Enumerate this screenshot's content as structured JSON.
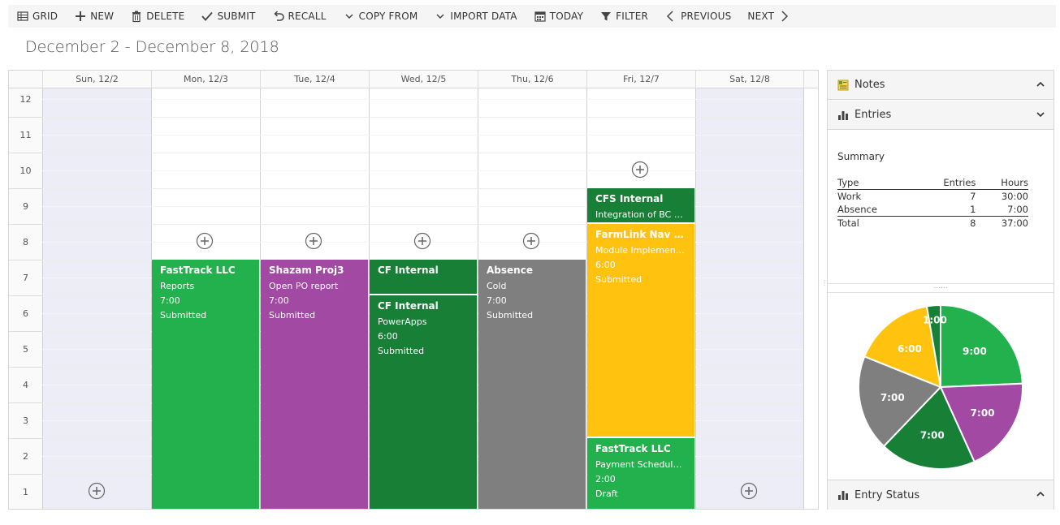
{
  "toolbar": {
    "grid": "GRID",
    "new": "NEW",
    "delete": "DELETE",
    "submit": "SUBMIT",
    "recall": "RECALL",
    "copy_from": "COPY FROM",
    "import_data": "IMPORT DATA",
    "today": "TODAY",
    "filter": "FILTER",
    "previous": "PREVIOUS",
    "next": "NEXT"
  },
  "title": "December 2 - December 8, 2018",
  "days": [
    "Sun, 12/2",
    "Mon, 12/3",
    "Tue, 12/4",
    "Wed, 12/5",
    "Thu, 12/6",
    "Fri, 12/7",
    "Sat, 12/8"
  ],
  "hours": [
    "12",
    "11",
    "10",
    "9",
    "8",
    "7",
    "6",
    "5",
    "4",
    "3",
    "2",
    "1"
  ],
  "entries": {
    "mon": {
      "title": "FastTrack LLC",
      "desc": "Reports",
      "hours": "7:00",
      "status": "Submitted",
      "color": "#22b14c"
    },
    "tue": {
      "title": "Shazam Proj3",
      "desc": "Open PO report",
      "hours": "7:00",
      "status": "Submitted",
      "color": "#a249a4"
    },
    "wed1": {
      "title": "CF Internal",
      "color": "#187f37"
    },
    "wed2": {
      "title": "CF Internal",
      "desc": "PowerApps",
      "hours": "6:00",
      "status": "Submitted",
      "color": "#187f37"
    },
    "thu": {
      "title": "Absence",
      "desc": "Cold",
      "hours": "7:00",
      "status": "Submitted",
      "color": "#7f7f7f"
    },
    "fri1": {
      "title": "CFS Internal",
      "desc": "Integration of BC to ...",
      "color": "#187f37"
    },
    "fri2": {
      "title": "FarmLink Nav Impl...",
      "desc": "Module Implementati...",
      "hours": "6:00",
      "status": "Submitted",
      "color": "#ffc20e"
    },
    "fri3": {
      "title": "FastTrack LLC",
      "desc": "Payment Schedule Re...",
      "hours": "2:00",
      "status": "Draft",
      "color": "#22b14c"
    }
  },
  "panel": {
    "notes": "Notes",
    "entries": "Entries",
    "entry_status": "Entry Status",
    "summary_title": "Summary",
    "summary": {
      "headers": [
        "Type",
        "Entries",
        "Hours"
      ],
      "rows": [
        {
          "type": "Work",
          "entries": "7",
          "hours": "30:00"
        },
        {
          "type": "Absence",
          "entries": "1",
          "hours": "7:00"
        }
      ],
      "total": {
        "type": "Total",
        "entries": "8",
        "hours": "37:00"
      }
    }
  },
  "chart_data": {
    "type": "pie",
    "slices": [
      {
        "label": "9:00",
        "value": 9,
        "color": "#22b14c"
      },
      {
        "label": "7:00",
        "value": 7,
        "color": "#a249a4"
      },
      {
        "label": "7:00",
        "value": 7,
        "color": "#187f37"
      },
      {
        "label": "7:00",
        "value": 7,
        "color": "#7f7f7f"
      },
      {
        "label": "6:00",
        "value": 6,
        "color": "#ffc20e"
      },
      {
        "label": "1:00",
        "value": 1,
        "color": "#187f37"
      }
    ]
  }
}
